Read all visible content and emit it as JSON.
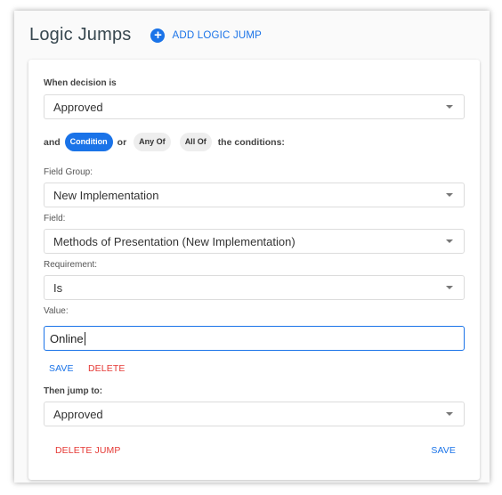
{
  "header": {
    "title": "Logic Jumps",
    "add_icon": "plus-circle-icon",
    "add_label": "ADD LOGIC JUMP"
  },
  "decision": {
    "label": "When decision is",
    "value": "Approved"
  },
  "conditions": {
    "and": "and",
    "chips": [
      "Condition",
      "Any Of",
      "All Of"
    ],
    "active": "Condition",
    "or": "or",
    "suffix": "the conditions:"
  },
  "field_group": {
    "label": "Field Group:",
    "value": "New Implementation"
  },
  "field": {
    "label": "Field:",
    "value": "Methods of Presentation (New Implementation)"
  },
  "requirement": {
    "label": "Requirement:",
    "value": "Is"
  },
  "value_field": {
    "label": "Value:",
    "value": "Online"
  },
  "condition_actions": {
    "save": "SAVE",
    "delete": "DELETE"
  },
  "jump": {
    "label": "Then jump to:",
    "value": "Approved"
  },
  "footer": {
    "delete_jump": "DELETE JUMP",
    "save": "SAVE"
  },
  "colors": {
    "accent": "#1a73e8",
    "danger": "#e53935"
  }
}
